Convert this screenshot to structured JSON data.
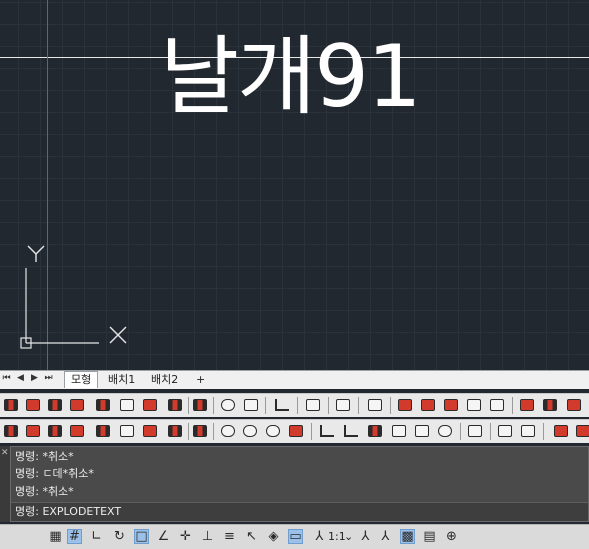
{
  "drawing": {
    "text": "날개91",
    "ucs_x_label": "X",
    "ucs_y_label": "Y"
  },
  "layout_tabs": {
    "nav_first": "⏮",
    "nav_prev": "◀",
    "nav_next": "▶",
    "nav_last": "⏭",
    "tabs": [
      {
        "label": "모형",
        "active": true
      },
      {
        "label": "배치1",
        "active": false
      },
      {
        "label": "배치2",
        "active": false
      }
    ],
    "add_tab": "+"
  },
  "command_history": [
    "명령: *취소*",
    "명령: ㄷ데*취소*",
    "명령: *취소*"
  ],
  "command_input": {
    "value": "명령: EXPLODETEXT"
  },
  "status_bar": {
    "scale_label": "1:1",
    "scale_dropdown": "⌄"
  },
  "colors": {
    "canvas_bg": "#212830",
    "grid_minor": "#2a323c",
    "grid_major": "#313a45",
    "crosshair_y_axis": "#2c8a3c",
    "tool_red": "#d23a2b"
  }
}
